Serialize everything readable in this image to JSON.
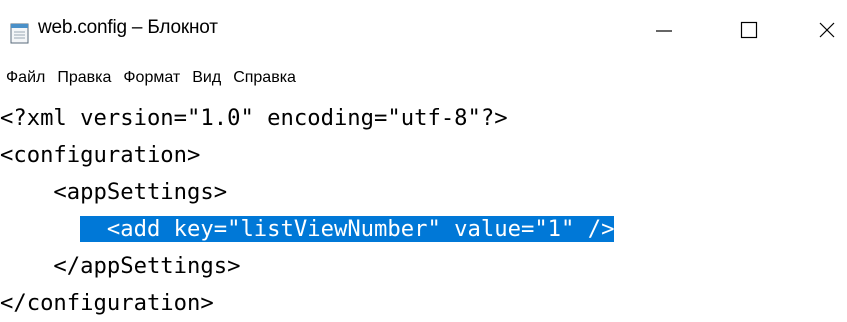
{
  "window": {
    "title": "web.config – Блокнот",
    "app_icon": "notepad-icon",
    "controls": {
      "minimize_icon": "minimize-icon",
      "maximize_icon": "maximize-icon",
      "close_icon": "close-icon"
    }
  },
  "menu": {
    "items": [
      "Файл",
      "Правка",
      "Формат",
      "Вид",
      "Справка"
    ]
  },
  "editor": {
    "lines": [
      "<?xml version=\"1.0\" encoding=\"utf-8\"?>",
      "<configuration>",
      "    <appSettings>",
      "        <add key=\"listViewNumber\" value=\"1\" />",
      "    </appSettings>",
      "</configuration>"
    ],
    "selected_line_indent": "      ",
    "selected_text": "  <add key=\"listViewNumber\" value=\"1\" />",
    "selection_color": "#0078d7",
    "selection_text_color": "#ffffff"
  }
}
